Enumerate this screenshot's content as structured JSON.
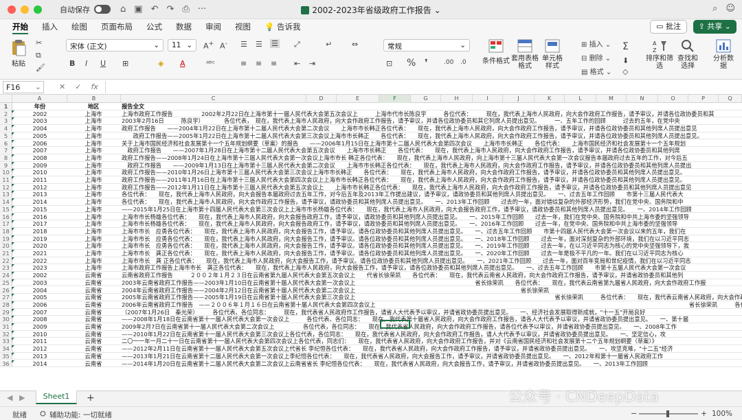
{
  "titlebar": {
    "autosave_label": "自动保存",
    "document_title": "2002-2023年省级政府工作报告"
  },
  "tabs": [
    "开始",
    "插入",
    "绘图",
    "页面布局",
    "公式",
    "数据",
    "审阅",
    "视图",
    "告诉我"
  ],
  "buttons": {
    "comment": "批注",
    "share": "共享"
  },
  "ribbon": {
    "paste": "粘贴",
    "font_name": "宋体 (正文)",
    "font_size": "11",
    "number_format": "常规",
    "conditional_format": "条件格式",
    "table_format": "套用表格格式",
    "cell_style": "单元格样式",
    "insert": "插入",
    "delete": "删除",
    "format": "格式",
    "sort_filter": "排序和筛选",
    "find_select": "查找和选择",
    "analyze": "分析数据"
  },
  "namebox": "F16",
  "fx_label": "fx",
  "columns": [
    "A",
    "B",
    "C",
    "D",
    "E",
    "F",
    "G",
    "H",
    "I",
    "J",
    "K",
    "L",
    "M",
    "N",
    "O",
    "P",
    "Q"
  ],
  "rows": [
    [
      "1",
      "年份",
      "地区",
      "报告全文"
    ],
    [
      "2",
      "2002",
      "上海市",
      "上海市政府工作报告　　　　　2002年2月22日在上海市第十一届人民代表大会第五次会议上　　　上海市代市长陈良宇　　　各位代表：　　　现在，我代表上海市人民政府，向大会作政府工作报告，请予审议，并请各位政协委员和其"
    ],
    [
      "3",
      "2003",
      "上海市",
      "2003年2月16日　　　陈良宇）　　　　各位代表，　现在，我代表上海市人民政府，向大会作政府工作报告，请予审议，并请各位政协委员和其它列席人员提出意见。　　　一、五年工作的回顾　　　过去的五年，在党中央"
    ],
    [
      "4",
      "2004",
      "上海市",
      "政府工作报告　　——2004年1月22日在上海市第十二届人民代表大会第二次会议　　上海市市长韩正各位代表：　　现在，我代表上海市人民政府，向大会作政府工作报告，请予审议，并请各位政协委员和其他列席人员提出意见"
    ],
    [
      "5",
      "2005",
      "上海市",
      "　　政府工作报告——2005年1月22日在上海市第十二届人民代表大会第三次会议上海市市长韩正　　各位代表：　　现在，我代表上海市人民政府，向大会作政府工作报告，请予审议，并请各位政协委员和其他列席人员提出意见。"
    ],
    [
      "6",
      "2006",
      "上海市",
      "关于上海市国民经济和社会发展第十一个五年规划纲要（草案）的报告　　——2006年1月15日在上海市第十二届人民代表大会第四次会议　　上海市市长韩正　　各位代表：　　上海市国民经济和社会发展第十一个五年规划"
    ],
    [
      "7",
      "2007",
      "上海市",
      "　政府工作报告　　——2007年1月28日在上海市第十二届人民代表大会第五次会议　　上海市市长韩正　　各位代表：　　现在，我代表上海市人民政府，向大会作政府工作报告，请予审议，并请各位政协委员和其他列席"
    ],
    [
      "8",
      "2008",
      "上海市",
      "政府工作报告——2008年1月24日在上海市第十三届人民代表大会第一次会议上海市市长 韩正各位代表：　　现在，我代表上海市人民政府，向上海市第十三届人民代表大会第一次会议报告本届政府过去五年的工作，对今后五"
    ],
    [
      "9",
      "2009",
      "上海市",
      "　政府工作报告　　——2009年1月13日在上海市第十三届人民代表大会第二次会议　　上海市市长韩正各位代表：　　现在，我代表上海市人民政府，向大会作政府工作报告，请予审议，并请各位政协委员和其他列席人员提出"
    ],
    [
      "10",
      "2010",
      "上海市",
      "政府工作报告——2010年1月26日上海市第十三届人民代表大会第三次会议上海市市长韩正　　各位代表：　　现在，我代表上海市人民政府，向大会作政府工作报告，请予审议，并请各位政协委员和其他列席人员提出意见。"
    ],
    [
      "11",
      "2011",
      "上海市",
      "政府工作报告——2011年1月16日在上海市第十三届人民代表大会第四次会议上上海市市长韩正各位代表：　　现在，我代表上海市人民政府，向大会作政府工作报告，请予审议，并请各位政协委员和其他列席人员提出意见。"
    ],
    [
      "12",
      "2012",
      "上海市",
      "政府工作报告——2012年1月11日在上海市第十三届人民代表大会第五次会议上　　上海市市长韩正各位代表：　　现在，我代表上海市人民政府，向大会作政府工作报告，请予审议，并请各位政协委员和其他列席人员提出意见"
    ],
    [
      "13",
      "2013",
      "上海市",
      "各位代表：　　现在，我代表上海市人民政府，向大会报告本届政府过去五年工作，对今后五年及2013年工作提出建议，请予审议，请政协委员和其他列席人员提出意见。　　一、过去五年工作回顾　　市第十三届人民代表大"
    ],
    [
      "14",
      "2014",
      "上海市",
      "各位代表：　　现在，我代表上海市人民政府，向大会作政府工作报告，请予审议，请政协委员和其他列席人员提出意见。　　一、2013年工作回顾　　过去的一年，面对错综复杂的外部经济形势，我们在党中央、国务院和中"
    ],
    [
      "15",
      "2015",
      "上海市",
      "——2015年1月25日在上海市第十四届人民代表大会第三次会议上上海市市长杨雄各位代表：　　现在，我代表上海市人民政府，向大会报告政府工作，请予审议，请政协委员和其他列席人员提出意见。　　一、2014年工作回顾"
    ],
    [
      "16",
      "2016",
      "上海市",
      "上海市市长杨雄各位代表：　　现在，我代表上海市人民政府，向大会报告政府工作，请予审议，请政协委员和其他列席人员提出意见。　　一、2015年工作回顾　　过去一年，我们在党中央、国务院和中共上海市委的坚强领导"
    ],
    [
      "17",
      "2017",
      "上海市",
      "上海市市长杨雄各位代表：　　现在，我代表上海市人民政府，向大会报告政府工作，请予审议，请政协委员和其他列席人员提出意见。　　一、2016年工作回顾　　过去一年，在党中央、国务院和中共上海市委的坚强领导"
    ],
    [
      "18",
      "2018",
      "上海市",
      "上海市市长　应勇各位代表：　　现在，我代表上海市人民政府，向大会报告工作，请予审议。请各位政协委员和其他列席人员提出意见。　　一、过去五年工作回顾　　市第十四届人民代表大会第一次会议以来的五年，我们在"
    ],
    [
      "19",
      "2019",
      "上海市",
      "上海市市长　应勇各位代表：　　现在，我代表上海市人民政府，向大会报告工作，请予审议。请各位政协委员和其他列席人员提出意见。　　一、2018年工作回顾　　过去一年，面对深刻复杂的外部环境，我们在以习近平同志"
    ],
    [
      "20",
      "2020",
      "上海市",
      "上海市市长　应勇各位代表：　　现在，我代表上海市人民政府，向大会报告工作，请予审议。请各位政协委员和其他列席人员提出意见。　　一、2019年工作回顾　　过去一年，在以习近平同志为核心的党中央坚强领导下，我"
    ],
    [
      "21",
      "2021",
      "上海市",
      "上海市市长　龚正各位代表：　　现在，我代表上海市人民政府，向大会报告工作，请予审议。请各位政协委员和其他列席人员提出意见。　　一、2020年工作回顾　　过去一年是极不平凡的一年。我们在以习近平同志为核心"
    ],
    [
      "22",
      "2022",
      "上海市",
      "上海市市长　龚 正各位代表：　　现在，我代表上海市人民政府，向大会报告工作，请予审议。请各位政协委员和其他列席人员提出意见。　　一、2021年工作回顾　　过去一年，面对百年变局和世纪疫情，我们在以习近平同志"
    ],
    [
      "23",
      "2023",
      "上海市",
      "上海市政府工作报告上海市市长　龚正各位代表：　　现在，我代表上海市人民政府，向大会报告工作，请予审议，请各位政协委员和其他列席人员提出意见。　　一、过去五年工作回顾　　市第十五届人民代表大会第一次会议"
    ],
    [
      "24",
      "2002",
      "云南省",
      "云南省政府工作报告　　　２００２年１月２３日在云南省第九届人民代表大会第五次会议上　　代省长徐荣凯　　各位代表：　　现在，我代表云南省人民政府，向大会作政府工作报告，请予审议，并请省政协委员和其他列"
    ],
    [
      "25",
      "2003",
      "云南省",
      "2003年云南省政府工作报告——2003年1月10日在云南省第十届人民代表大会第一次会议上　　　　　　　　　　　　　　　　　　　　　省长徐荣凯　　各位代表：　　现在，我代表云南省第九届省人民政府，向大会作政府工作报"
    ],
    [
      "26",
      "2004",
      "云南省",
      "2004年云南省政府工作报告——2004年2月12日在云南省第十届人民代表大会第二次会议上　　　　　　　　　　　　　　　　　　　　　　　　　　　　　省长徐荣凯"
    ],
    [
      "27",
      "2005",
      "云南省",
      "2005年云南省政府工作报告——2005年1月19日在云南省第十届人民代表大会第三次会议上　　　　　　　　　　　　　　　　　　　　　　　　　　　　　　　　　　　省长徐荣凯　　　各位代表：　　现在，我代表云南省人民政府，向大会作政府工作报告"
    ],
    [
      "28",
      "2006",
      "云南省",
      "2006年云南省政府工作报告　——２００６年１月１６日在云南省第十届人民代表大会第四次会议上　　　　　　　　　　　　　　　　　　　　　　　　　　　　　　　　　　　　　　　　　　　　　　　　　　　　　　　省长徐荣凯　　　各位代表：　　现在，我代"
    ],
    [
      "29",
      "2007",
      "云南省",
      "（2007年1月26日　秦光荣）　　　各位代表、各位同志：　　　现在，我代表省人民政府作工作报告，请省人大代表予以审议，并请省政协委员提出意见。　　一、经济社会发展取得新成就，\"十一五\"开局良好　　"
    ],
    [
      "30",
      "2008",
      "云南省",
      "——2008年1月18日在云南省第十一届人民代表大会第一次会议上　　　各位代表、各位同志：　　现在，我代表第十届省人民政府，向大会作政府工作报告，请各人大代表予以审议，并请省政协委员提出意见。　　一、第十届"
    ],
    [
      "31",
      "2009",
      "云南省",
      "2009年2月7日在云南省第十一届人民代表大会第二次会议上　　　　　各位代表，各位同志：　　现在，我代表省人民政府，向大会作政府工作报告，请各位代表予以审议，并请省政协委员提出意见。　　一、2008年工作"
    ],
    [
      "32",
      "2010",
      "云南省",
      "——2010年1月22日在云南省第十一届人民代表大会第三次会议上各位代表，各位同志：　　现在，我代表省人民政府，向大会作政府工作报告，请人大代表予以审议，并请省政协委员提出意见。　　一、坚定信心，攻"
    ],
    [
      "33",
      "2011",
      "云南省",
      "二〇一一年一月二十一日在云南省第十一届人民代表大会第四次会议上各位代表，同志们：　　现在，我代表省人民政府，向大会作政府工作报告，并对《云南省国民经济和社会发展第十二个五年规划纲要（草案）》"
    ],
    [
      "34",
      "2012",
      "云南省",
      "——2012年2月11日在云南省第十一届人民代表大会第五次会议上代省长 李纪恒各位代表：　　现在，我代表省人民政府，向大会作政府工作报告，请予审议，并请省政协委员提出意见。　　一、攻坚克难，\"十二五\"经济"
    ],
    [
      "35",
      "2013",
      "云南省",
      "——2013年1月21日在云南省第十二届人民代表大会第一次会议上李纪恒各位代表：　　现在，我代表省人民政府，向大会报告工作，请予审议，并请省政协委员提出意见。　　一、2012年和第十一届省人民政府工作"
    ],
    [
      "36",
      "2014",
      "云南省",
      "——2014年1月20日在云南省第十二届人民代表大会第二次会议上云南省省长 李纪恒各位代表：　　现在，我代表省人民政府，向大会报告工作，请予审议，并请省政协委员提出意见。　　一、2013年工作回顾"
    ]
  ],
  "sheet_tab": "Sheet1",
  "status": {
    "ready": "就绪",
    "accessibility": "辅助功能: 一切就绪",
    "zoom": "100%"
  },
  "watermark": "公众号 · CNDeepData"
}
